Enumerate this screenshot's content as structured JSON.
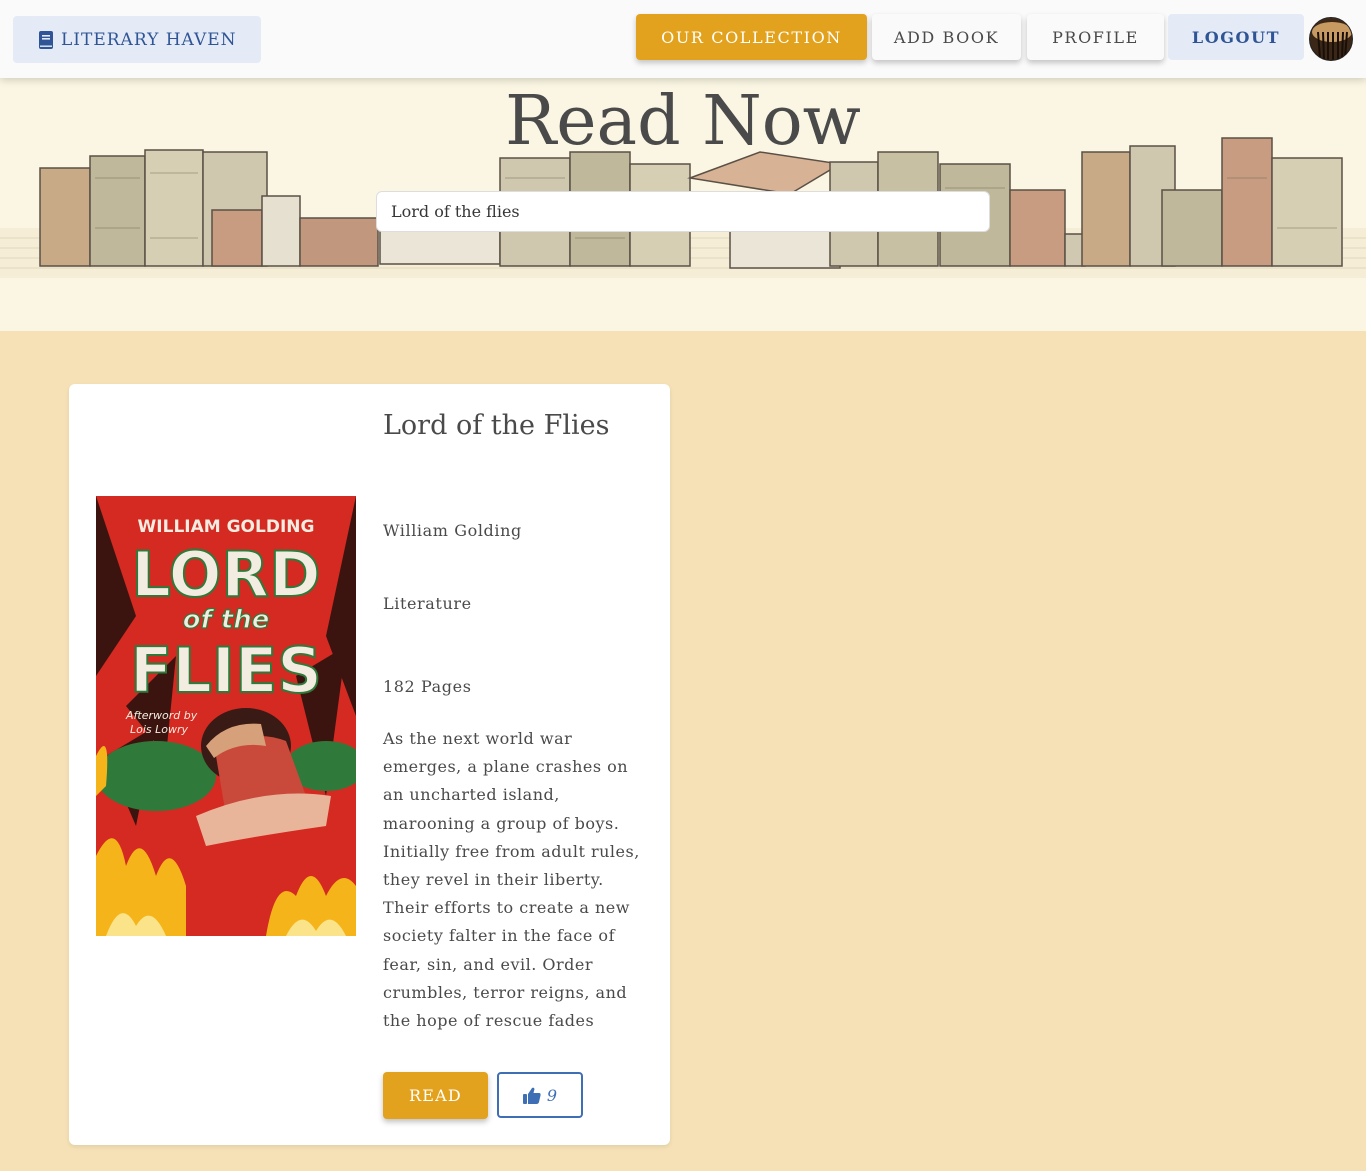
{
  "navbar": {
    "brand": "LITERARY HAVEN",
    "brand_icon": "book-icon",
    "links": {
      "collection": "OUR COLLECTION",
      "add_book": "ADD BOOK",
      "profile": "PROFILE",
      "logout": "LOGOUT"
    },
    "accent_color": "#e3a21d",
    "brand_color": "#2f5596"
  },
  "hero": {
    "title": "Read Now",
    "search_value": "Lord of the flies"
  },
  "book": {
    "title": "Lord of the Flies",
    "author": "William Golding",
    "genre": "Literature",
    "pages": "182 Pages",
    "description": "As the next world war emerges, a plane crashes on an uncharted island, marooning a group of boys. Initially free from adult rules, they revel in their liberty. Their efforts to create a new society falter in the face of fear, sin, and evil. Order crumbles, terror reigns, and the hope of rescue fades",
    "cover": {
      "author_line": "WILLIAM GOLDING",
      "title_top": "LORD",
      "title_mid": "of the",
      "title_bottom": "FLIES",
      "afterword_1": "Afterword by",
      "afterword_2": "Lois Lowry"
    },
    "read_label": "READ",
    "likes": "9",
    "like_icon": "thumbs-up-icon"
  }
}
